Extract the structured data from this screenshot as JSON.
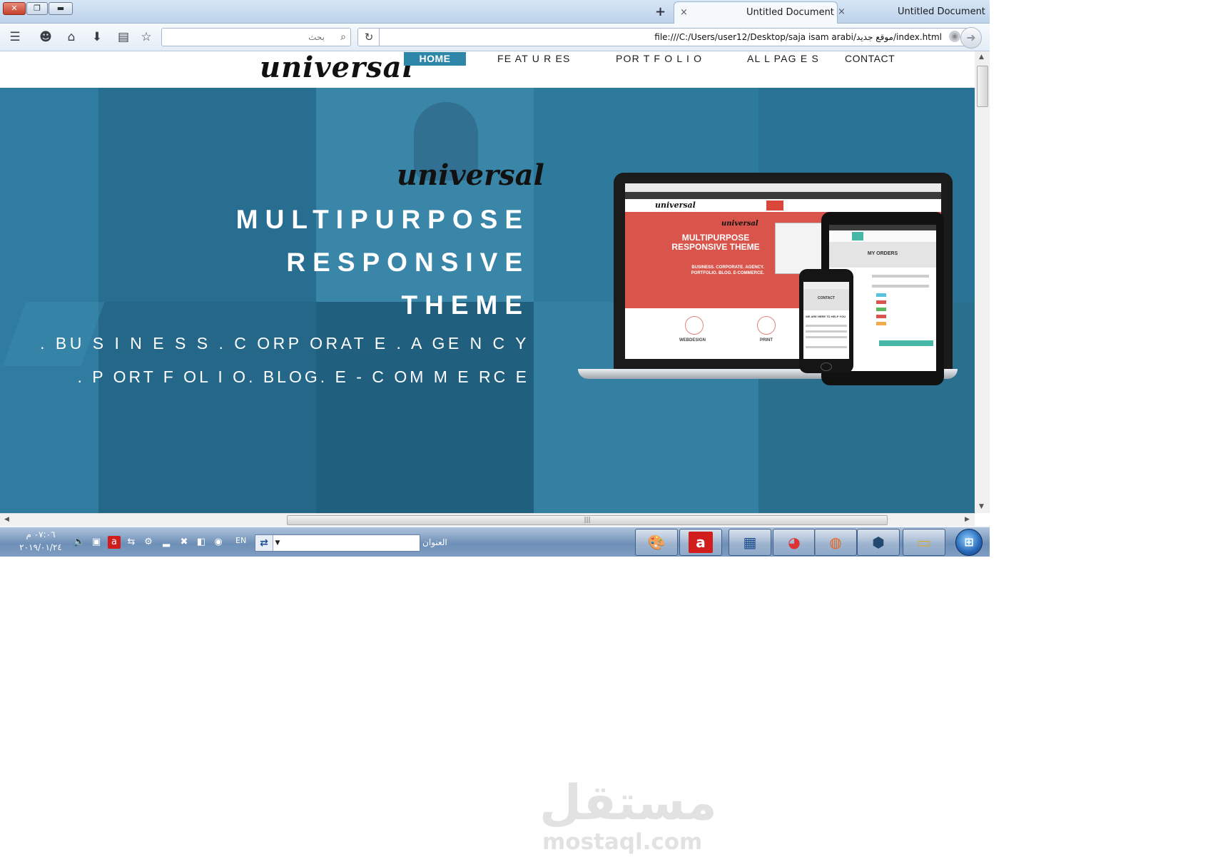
{
  "browser": {
    "tabs": [
      {
        "title": "Untitled Document",
        "active": true
      },
      {
        "title": "Untitled Document",
        "active": false
      }
    ],
    "new_tab_symbol": "+",
    "tab_close_symbol": "×",
    "search_placeholder": "بحث",
    "url": "file:///C:/Users/user12/Desktop/saja isam arabi/موقع جديد/index.html"
  },
  "site": {
    "logo": "universal",
    "menu": [
      {
        "label": "HOME",
        "active": true
      },
      {
        "label": "FE AT U R ES"
      },
      {
        "label": "POR T F O L I O"
      },
      {
        "label": "AL L PAG E S"
      },
      {
        "label": "CONTACT"
      }
    ],
    "hero": {
      "logo": "universal",
      "line1": "MULTIPURPOSE",
      "line2": "RESPONSIVE",
      "line3": "THEME",
      "line4": ". BU S I N E S S . C ORP ORAT E . A GE N C Y",
      "line5": ". P ORT F OL I O. BLOG. E - C OM M E RC E"
    },
    "mockup": {
      "laptop_logo": "universal",
      "laptop_hero_logo": "universal",
      "laptop_hero_text": "MULTIPURPOSE RESPONSIVE THEME",
      "laptop_hero_sub": "BUSINESS. CORPORATE. AGENCY. PORTFOLIO. BLOG. E-COMMERCE.",
      "laptop_service1": "WEBDESIGN",
      "laptop_service2": "PRINT",
      "tablet_heading": "MY ORDERS",
      "phone_heading": "CONTACT",
      "phone_subheading": "WE ARE HERE TO HELP YOU"
    }
  },
  "taskbar": {
    "clock_time": "٠٧:٠٦ م",
    "clock_date": "٢٠١٩/٠١/٢٤",
    "language": "EN",
    "address_label": "العنوان",
    "apps": [
      "paint",
      "avira",
      "remote-desktop",
      "chrome",
      "firefox",
      "virtualbox",
      "explorer"
    ]
  },
  "watermark": {
    "arabic": "مستقل",
    "latin": "mostaql.com"
  },
  "colors": {
    "hero_blue": "#2a7396",
    "menu_active": "#2e86a8",
    "mock_red": "#d9544a"
  }
}
